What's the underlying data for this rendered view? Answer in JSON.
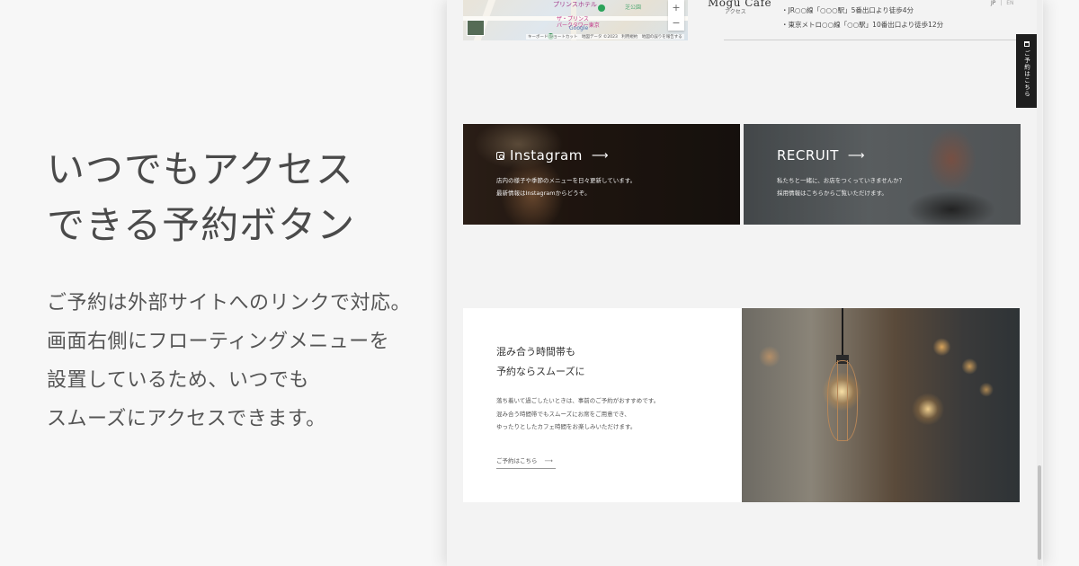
{
  "promo": {
    "heading": [
      "いつでもアクセス",
      "できる予約ボタン"
    ],
    "body": [
      "ご予約は外部サイトへのリンクで対応。",
      "画面右側にフローティングメニューを",
      "設置しているため、いつでも",
      "スムーズにアクセスできます。"
    ]
  },
  "map": {
    "label_1": "プリンスホテル",
    "label_2": "ザ・プリンス\nパークタワー東京",
    "label_3": "芝公園",
    "google": "Google",
    "attribution": "キーボード ショートカット　地図データ ©2023　利用規約　地図の誤りを報告する",
    "zoom_in": "+",
    "zoom_out": "−"
  },
  "store": {
    "brand": "Mogu Cafe",
    "access_label": "アクセス",
    "access_lines": [
      "・JR○○線「○○○駅」5番出口より徒歩4分",
      "・東京メトロ○○線「○○駅」10番出口より徒歩12分"
    ]
  },
  "lang": {
    "jp": "JP",
    "sep": "|",
    "en": "EN"
  },
  "cards": {
    "instagram": {
      "title": "Instagram",
      "arrow": "⟶",
      "lines": [
        "店内の様子や季節のメニューを日々更新しています。",
        "最新情報はInstagramからどうぞ。"
      ]
    },
    "recruit": {
      "title": "RECRUIT",
      "arrow": "⟶",
      "lines": [
        "私たちと一緒に、お店をつくっていきませんか？",
        "採用情報はこちらからご覧いただけます。"
      ]
    }
  },
  "feature": {
    "title": [
      "混み合う時間帯も",
      "予約ならスムーズに"
    ],
    "desc": [
      "落ち着いて過ごしたいときは、事前のご予約がおすすめです。",
      "混み合う時間帯でもスムーズにお席をご用意でき、",
      "ゆったりとしたカフェ時間をお楽しみいただけます。"
    ],
    "link": "ご予約はこちら",
    "link_arrow": "⟶"
  },
  "float_button": {
    "label": "ご予約はこちら"
  }
}
